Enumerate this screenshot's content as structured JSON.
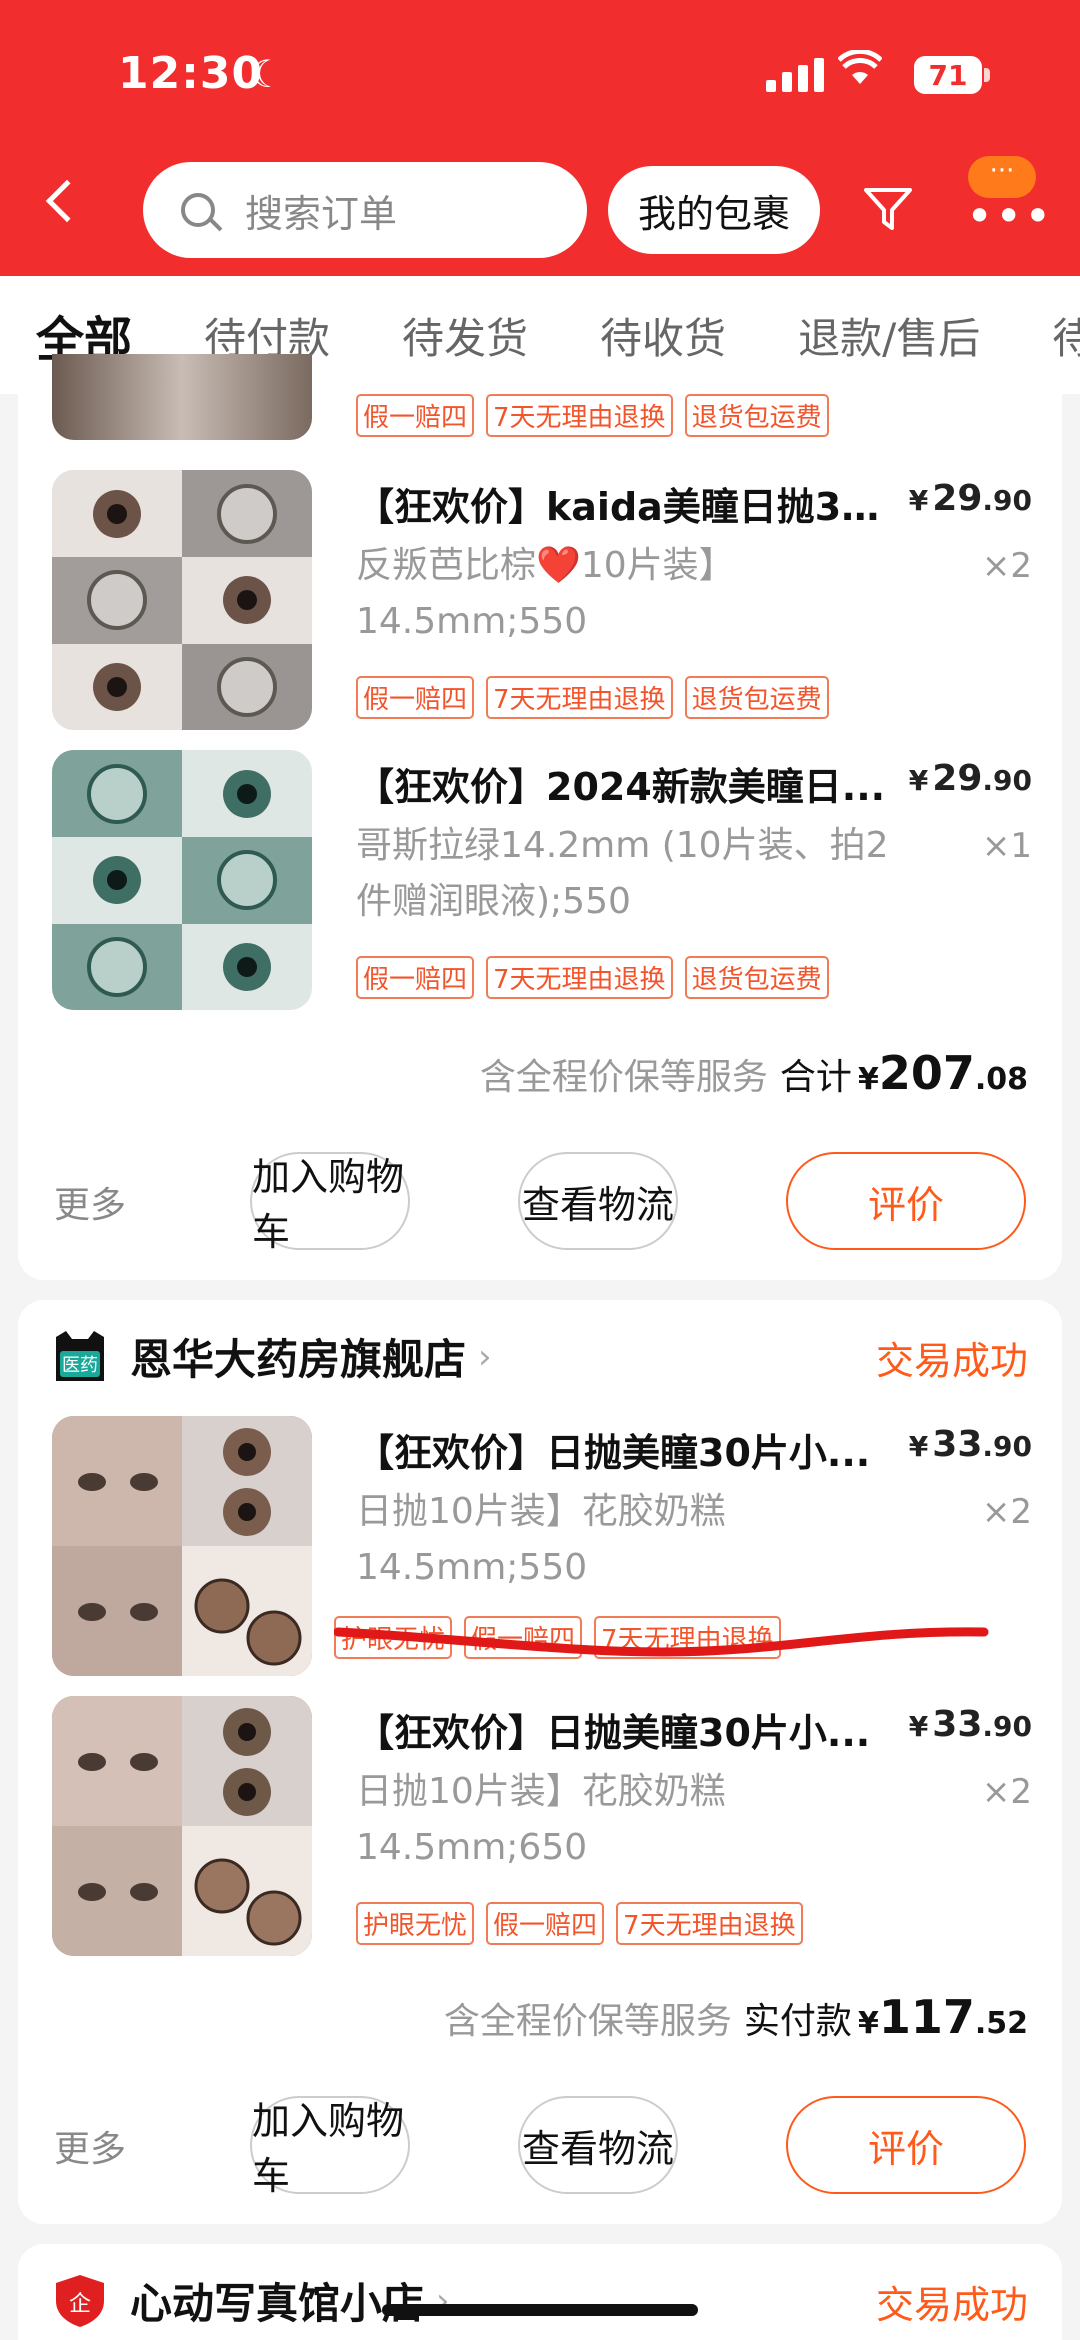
{
  "status_bar": {
    "time": "12:30",
    "battery": "71"
  },
  "header": {
    "search_placeholder": "搜索订单",
    "parcel_button": "我的包裹",
    "more_badge": "···"
  },
  "tabs": [
    "全部",
    "待付款",
    "待发货",
    "待收货",
    "退款/售后",
    "待评价"
  ],
  "order1": {
    "items": [
      {
        "title": "【狂欢价】kaida美瞳日抛30...",
        "spec": "反叛芭比棕❤️10片装】 14.5mm;550",
        "price_int": "29",
        "price_dec": ".90",
        "qty": "×2",
        "tags": [
          "假一赔四",
          "7天无理由退换",
          "退货包运费"
        ]
      },
      {
        "title": "【狂欢价】2024新款美瞳日...",
        "spec": "哥斯拉绿14.2mm (10片装、拍2件赠润眼液);550",
        "price_int": "29",
        "price_dec": ".90",
        "qty": "×1",
        "tags": [
          "假一赔四",
          "7天无理由退换",
          "退货包运费"
        ]
      }
    ],
    "partial_tags": [
      "假一赔四",
      "7天无理由退换",
      "退货包运费"
    ],
    "service_note": "含全程价保等服务",
    "total_label": "合计",
    "total_int": "207",
    "total_dec": ".08",
    "more": "更多",
    "buttons": {
      "cart": "加入购物车",
      "logistics": "查看物流",
      "review": "评价"
    }
  },
  "order2": {
    "store_name": "恩华大药房旗舰店",
    "store_badge": "医药",
    "status": "交易成功",
    "items": [
      {
        "title": "【狂欢价】日抛美瞳30片小...",
        "spec": "日抛10片装】花胶奶糕 14.5mm;550",
        "price_int": "33",
        "price_dec": ".90",
        "qty": "×2",
        "tags": [
          "护眼无忧",
          "假一赔四",
          "7天无理由退换"
        ]
      },
      {
        "title": "【狂欢价】日抛美瞳30片小...",
        "spec": "日抛10片装】花胶奶糕 14.5mm;650",
        "price_int": "33",
        "price_dec": ".90",
        "qty": "×2",
        "tags": [
          "护眼无忧",
          "假一赔四",
          "7天无理由退换"
        ]
      }
    ],
    "service_note": "含全程价保等服务",
    "total_label": "实付款",
    "total_int": "117",
    "total_dec": ".52",
    "more": "更多",
    "buttons": {
      "cart": "加入购物车",
      "logistics": "查看物流",
      "review": "评价"
    }
  },
  "order3": {
    "store_name": "心动写真馆小店",
    "status": "交易成功"
  },
  "currency": "¥",
  "colors": {
    "header": "#f12d2d",
    "accent": "#ff5a1a",
    "tag": "#f2552c"
  }
}
